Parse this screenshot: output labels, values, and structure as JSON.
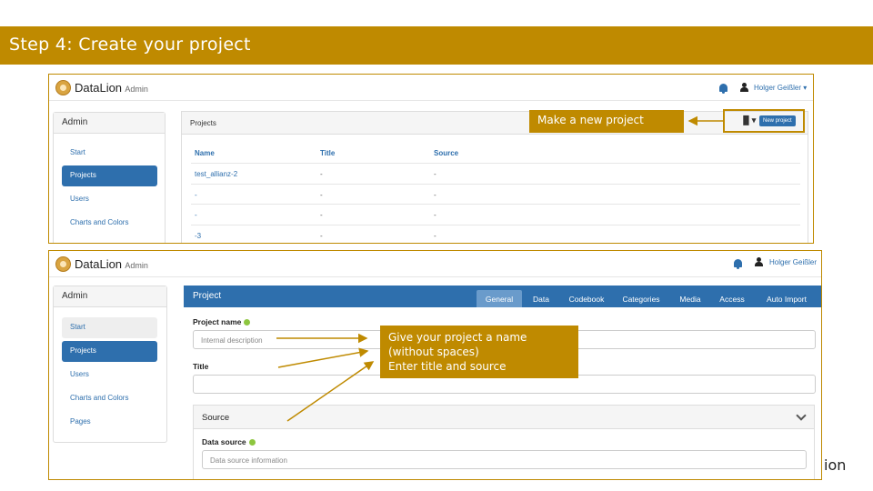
{
  "banner": {
    "title": "Step 4: Create your project"
  },
  "shot1": {
    "brand": "DataLion",
    "brand_sub": "Admin",
    "user": "Holger Geißler ▾",
    "sidebar": {
      "title": "Admin",
      "items": [
        "Start",
        "Projects",
        "Users",
        "Charts and Colors"
      ],
      "active": "Projects"
    },
    "panel_title": "Projects",
    "toolbar_icon": "▐▌▾",
    "new_project": "New project",
    "table": {
      "headers": [
        "Name",
        "Title",
        "Source"
      ],
      "rows": [
        [
          "test_allianz-2",
          "-",
          "-"
        ],
        [
          "-",
          "-",
          "-"
        ],
        [
          "-",
          "-",
          "-"
        ],
        [
          "-3",
          "-",
          "-"
        ]
      ]
    }
  },
  "shot2": {
    "brand": "DataLion",
    "brand_sub": "Admin",
    "user": "Holger Geißler",
    "sidebar": {
      "title": "Admin",
      "items": [
        "Start",
        "Projects",
        "Users",
        "Charts and Colors",
        "Pages"
      ],
      "active": "Projects"
    },
    "header_title": "Project",
    "tabs": [
      "General",
      "Data",
      "Codebook",
      "Categories",
      "Media",
      "Access",
      "Auto Import"
    ],
    "active_tab": "General",
    "project_name_label": "Project name",
    "project_name_placeholder": "Internal description",
    "title_label": "Title",
    "source_section": "Source",
    "data_source_label": "Data source",
    "data_source_placeholder": "Data source information"
  },
  "callouts": {
    "new_project": "Make a new project",
    "name_line1": "Give your project a name",
    "name_line2": "(without spaces)",
    "name_line3": "Enter title and source"
  },
  "side_fragment": "ion",
  "colors": {
    "accent": "#BF8A00",
    "primary": "#2E6FAD"
  }
}
